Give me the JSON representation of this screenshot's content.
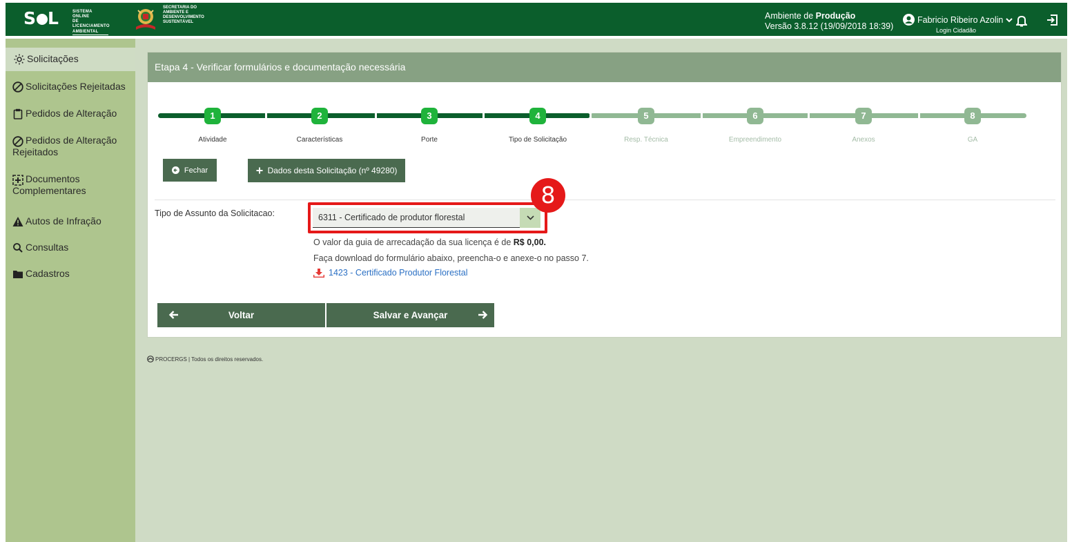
{
  "header": {
    "logo_text": "S",
    "logo_text_end": "L",
    "logo_sub": [
      "SISTEMA ONLINE",
      "DE LICENCIAMENTO",
      "AMBIENTAL"
    ],
    "secretaria": [
      "SECRETARIA DO",
      "AMBIENTE E",
      "DESENVOLVIMENTO",
      "SUSTENTÁVEL"
    ],
    "env_prefix": "Ambiente de ",
    "env_name": "Produção",
    "version": "Versão 3.8.12 (19/09/2018 18:39)",
    "user_name": "Fabricio Ribeiro Azolin",
    "login_type": "Login Cidadão"
  },
  "sidebar": {
    "items": [
      {
        "label": "Solicitações",
        "icon": "sun-icon"
      },
      {
        "label": "Solicitações Rejeitadas",
        "icon": "ban-icon"
      },
      {
        "label": "Pedidos de Alteração",
        "icon": "clipboard-icon"
      },
      {
        "label": "Pedidos de Alteração Rejeitados",
        "icon": "ban-icon"
      },
      {
        "label": "Documentos Complementares",
        "icon": "plus-square-icon"
      },
      {
        "label": "Autos de Infração",
        "icon": "warning-icon"
      },
      {
        "label": "Consultas",
        "icon": "search-icon"
      },
      {
        "label": "Cadastros",
        "icon": "folder-icon"
      }
    ]
  },
  "panel": {
    "title": "Etapa 4 - Verificar formulários e documentação necessária",
    "steps": [
      {
        "n": "1",
        "label": "Atividade",
        "state": "done"
      },
      {
        "n": "2",
        "label": "Características",
        "state": "done"
      },
      {
        "n": "3",
        "label": "Porte",
        "state": "done"
      },
      {
        "n": "4",
        "label": "Tipo de Solicitação",
        "state": "done"
      },
      {
        "n": "5",
        "label": "Resp. Técnica",
        "state": "todo"
      },
      {
        "n": "6",
        "label": "Empreendimento",
        "state": "todo"
      },
      {
        "n": "7",
        "label": "Anexos",
        "state": "todo"
      },
      {
        "n": "8",
        "label": "GA",
        "state": "todo"
      }
    ],
    "close_label": "Fechar",
    "details_label": "Dados desta Solicitação (nº 49280)",
    "field_label": "Tipo de Assunto da Solicitacao:",
    "select_value": "6311 - Certificado de produtor florestal",
    "badge": "8",
    "info_fee_prefix": "O valor da guia de arrecadação da sua licença é de ",
    "info_fee_value": "R$ 0,00.",
    "info_download": "Faça download do formulário abaixo, preencha-o e anexe-o no passo 7.",
    "download_link": "1423 - Certificado Produtor Florestal",
    "back_label": "Voltar",
    "next_label": "Salvar e Avançar"
  },
  "footer": {
    "text": "PROCERGS | Todos os direitos reservados."
  },
  "colors": {
    "topbar": "#0b5e2c",
    "sidebar": "#aec58e",
    "step_done": "#1fb33b",
    "step_todo": "#90b893",
    "button": "#4a6a4f",
    "highlight": "#e51919"
  }
}
